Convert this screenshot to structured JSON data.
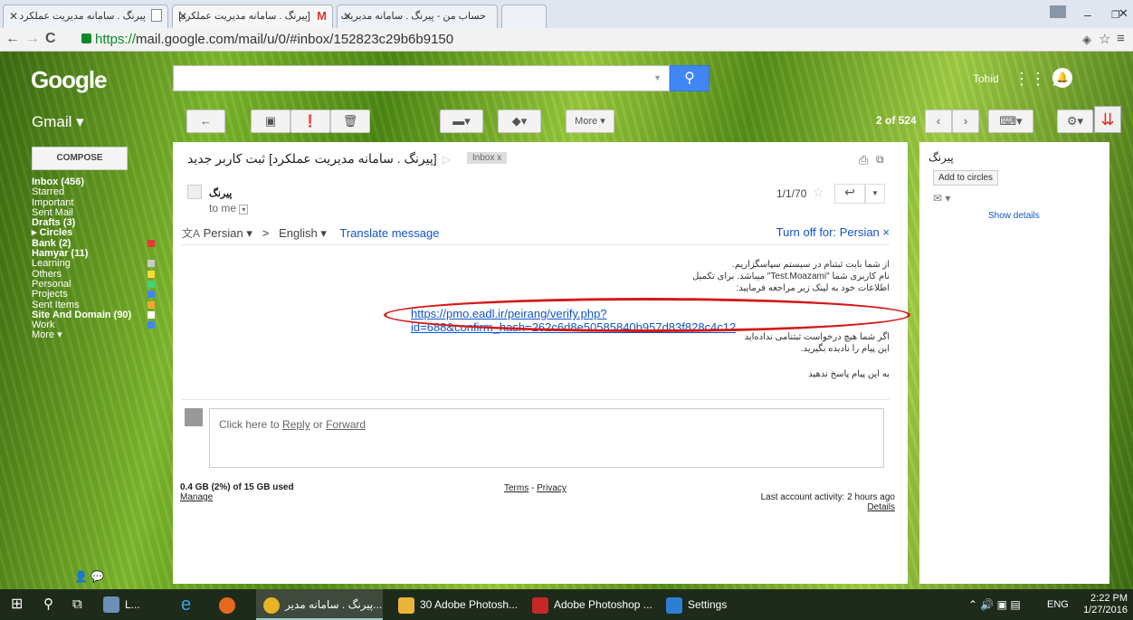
{
  "browser": {
    "tabs": [
      {
        "title": "پیرنگ . سامانه مدیریت عملکرد",
        "active": false
      },
      {
        "title": "[پیرنگ . سامانه مدیریت عملکرد]",
        "active": true
      },
      {
        "title": "حساب من - پیرنگ . سامانه مدیریت",
        "active": false
      }
    ],
    "url_scheme": "https://",
    "url_rest": "mail.google.com/mail/u/0/#inbox/152823c29b6b9150"
  },
  "header": {
    "logo": "Google",
    "user": "Tohid"
  },
  "toolbar": {
    "more": "More ▾",
    "pager": "2 of 524"
  },
  "gmail_label": "Gmail ▾",
  "compose": "COMPOSE",
  "nav": [
    {
      "label": "Inbox (456)",
      "bold": true,
      "color": ""
    },
    {
      "label": "Starred",
      "bold": false,
      "color": ""
    },
    {
      "label": "Important",
      "bold": false,
      "color": ""
    },
    {
      "label": "Sent Mail",
      "bold": false,
      "color": ""
    },
    {
      "label": "Drafts (3)",
      "bold": true,
      "color": ""
    },
    {
      "label": "▸ Circles",
      "bold": true,
      "color": ""
    },
    {
      "label": "Bank (2)",
      "bold": true,
      "color": "#e53935"
    },
    {
      "label": "Hamyar (11)",
      "bold": true,
      "color": ""
    },
    {
      "label": "Learning",
      "bold": false,
      "color": "#cccccc"
    },
    {
      "label": "Others",
      "bold": false,
      "color": "#fdd835"
    },
    {
      "label": "Personal",
      "bold": false,
      "color": "#43d17a"
    },
    {
      "label": "Projects",
      "bold": false,
      "color": "#4285f4"
    },
    {
      "label": "Sent Items",
      "bold": false,
      "color": "#f4a62a"
    },
    {
      "label": "Site And Domain (90)",
      "bold": true,
      "color": "#ffffff"
    },
    {
      "label": "Work",
      "bold": false,
      "color": "#4285f4"
    },
    {
      "label": "More ▾",
      "bold": false,
      "color": ""
    }
  ],
  "message": {
    "subject": "[پیرنگ . سامانه مدیریت عملکرد] ثبت کاربر جدید",
    "label": "Inbox x",
    "sender": "پیرنگ",
    "to": "to me",
    "date": "1/1/70",
    "translate": {
      "from": "Persian ▾",
      "arrow": ">",
      "to": "English ▾",
      "action": "Translate message",
      "off": "Turn off for: Persian ×"
    },
    "lines_top": [
      "از شما بابت ثبتنام در سیستم سپاسگزاریم.",
      "نام کاربری شما \"Test.Moazami\" میباشد. برای تکمیل",
      "اطلاعات خود به لینک زیر مراجعه فرمایید:"
    ],
    "link": "https://pmo.eadl.ir/peirang/verify.php?id=688&confirm_hash=262c6d8e50585840b957d83f828c4c12",
    "lines_bottom": [
      "اگر شما هیچ درخواست ثبتنامی نداده‌اید",
      "این پیام را نادیده بگیرید.",
      "",
      "به این پیام پاسخ ندهید"
    ],
    "reply_prefix": "Click here to ",
    "reply": "Reply",
    "reply_or": " or ",
    "forward": "Forward"
  },
  "footer": {
    "storage": "0.4 GB (2%) of 15 GB used",
    "manage": "Manage",
    "terms": "Terms",
    "dash": " - ",
    "privacy": "Privacy",
    "activity": "Last account activity: 2 hours ago",
    "details": "Details"
  },
  "sidepanel": {
    "name": "پیرنگ",
    "add": "Add to circles",
    "show": "Show details"
  },
  "taskbar": {
    "items": [
      {
        "label": "L..."
      },
      {
        "label": "پیرنگ . سامانه مدیر..."
      },
      {
        "label": "30 Adobe Photosh..."
      },
      {
        "label": "Adobe Photoshop ..."
      },
      {
        "label": "Settings"
      }
    ],
    "lang": "ENG",
    "time": "2:22 PM",
    "date": "1/27/2016"
  }
}
